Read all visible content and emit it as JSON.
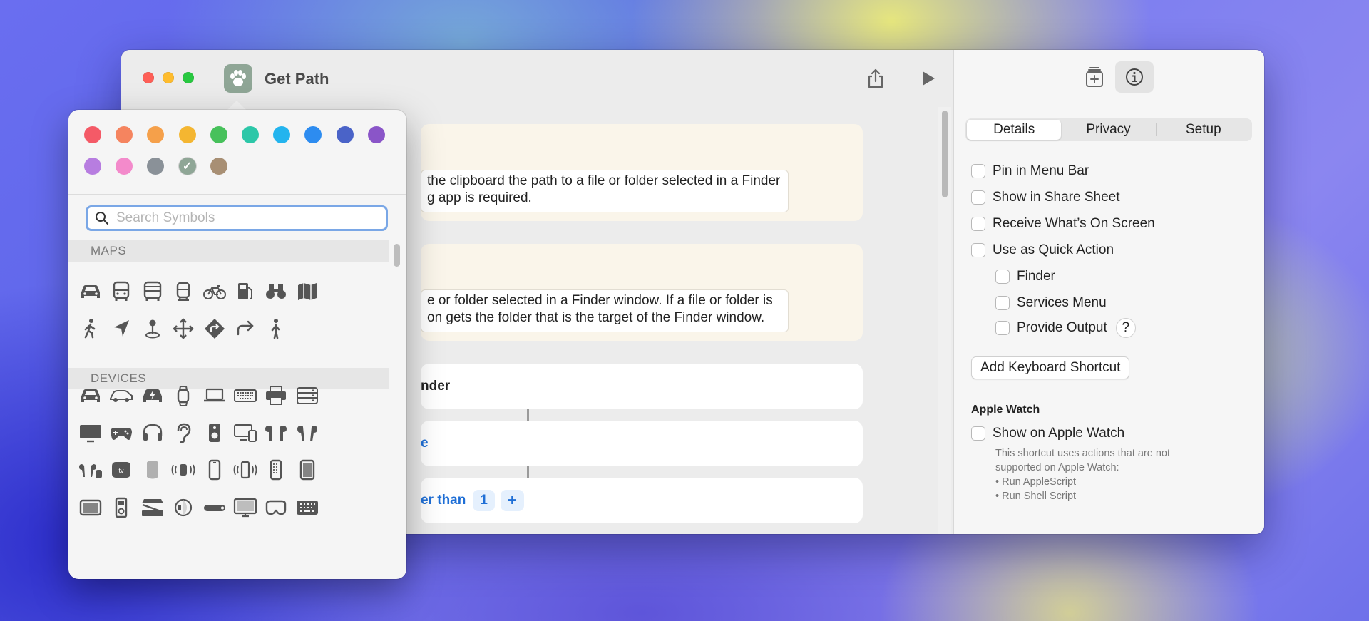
{
  "window": {
    "title": "Get Path",
    "app_icon": "paw-icon",
    "toolbar": {
      "share_icon": "share-icon",
      "run_icon": "play-icon"
    }
  },
  "editor": {
    "comment_1": {
      "lines": [
        "the clipboard the path to a file or folder selected in a Finder",
        "g app is required."
      ]
    },
    "comment_2": {
      "lines": [
        "e or folder selected in a Finder window. If a file or folder is",
        "on gets the folder that is the target of the Finder window."
      ]
    },
    "action_1": {
      "label": "nder"
    },
    "action_2": {
      "label": "e"
    },
    "action_3": {
      "label": "er than",
      "value": "1",
      "add": "+"
    }
  },
  "inspector": {
    "top_icons": [
      "add-to-library-icon",
      "info-icon"
    ],
    "tabs": [
      {
        "label": "Details",
        "active": true
      },
      {
        "label": "Privacy",
        "active": false
      },
      {
        "label": "Setup",
        "active": false
      }
    ],
    "options": [
      {
        "label": "Pin in Menu Bar",
        "checked": false
      },
      {
        "label": "Show in Share Sheet",
        "checked": false
      },
      {
        "label": "Receive What’s On Screen",
        "checked": false
      },
      {
        "label": "Use as Quick Action",
        "checked": false
      }
    ],
    "quick_action_options": [
      {
        "label": "Finder",
        "checked": false
      },
      {
        "label": "Services Menu",
        "checked": false
      },
      {
        "label": "Provide Output",
        "checked": false
      }
    ],
    "help_label": "?",
    "keyboard_shortcut_button": "Add Keyboard Shortcut",
    "apple_watch": {
      "heading": "Apple Watch",
      "option": {
        "label": "Show on Apple Watch",
        "checked": false
      },
      "note_lines": [
        "This shortcut uses actions that are not",
        "supported on Apple Watch:",
        "• Run AppleScript",
        "• Run Shell Script"
      ]
    }
  },
  "popover": {
    "colors": [
      "#f45a67",
      "#f5845f",
      "#f5a04a",
      "#f4b631",
      "#47c15b",
      "#2cc7a8",
      "#23b4ee",
      "#2d8cf0",
      "#4a63c8",
      "#8a55c8",
      "#b77de0",
      "#f38acb",
      "#8a9198",
      "#8fa696",
      "#a88f74"
    ],
    "selected_color_index": 13,
    "search_placeholder": "Search Symbols",
    "categories": [
      {
        "name": "MAPS",
        "symbols": [
          "car-icon",
          "bus-icon",
          "bus-front-icon",
          "tram-icon",
          "bicycle-icon",
          "fuel-pump-icon",
          "binoculars-icon",
          "map-icon",
          "walking-icon",
          "location-arrow-icon",
          "map-pin-icon",
          "move-arrows-icon",
          "turn-sign-icon",
          "turn-right-arrow-icon",
          "standing-figure-icon"
        ]
      },
      {
        "name": "DEVICES",
        "symbols": [
          "car-icon",
          "car-side-icon",
          "electric-car-icon",
          "watch-icon",
          "laptop-icon",
          "keyboard-icon",
          "printer-icon",
          "server-rack-icon",
          "display-icon",
          "gamecontroller-icon",
          "headphones-icon",
          "hearing-icon",
          "speaker-icon",
          "desktop-devices-icon",
          "airpods-icon",
          "airpods-pro-icon",
          "airpods-case-icon",
          "appletv-icon",
          "homepod-icon",
          "watch-wave-icon",
          "iphone-icon",
          "iphone-wave-icon",
          "ipod-icon",
          "ipad-icon",
          "ipad-landscape-icon",
          "ipod-classic-icon",
          "scanner-icon",
          "watch-side-icon",
          "remote-icon",
          "monitor-icon",
          "vision-pro-icon",
          "numeric-keypad-icon"
        ]
      }
    ]
  }
}
